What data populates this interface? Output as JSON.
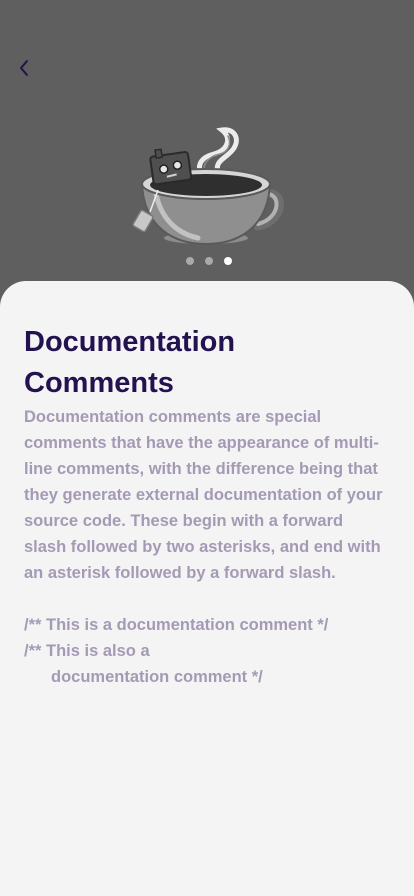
{
  "nav": {
    "back_icon": "chevron-left-icon"
  },
  "illustration": {
    "icon": "coffee-cup-robot-illustration"
  },
  "pager": {
    "count": 3,
    "active_index": 2
  },
  "content": {
    "title": "Documentation Comments",
    "paragraph": "Documentation comments are special comments that have the appearance of multi-line comments, with the difference being that they generate external documentation of your source code. These begin with a forward slash followed by two asterisks, and end with an asterisk followed by a forward slash.",
    "code_line_1": "/** This is a documentation comment */",
    "code_line_2": "/** This is also a",
    "code_line_3": "documentation comment */"
  },
  "colors": {
    "header_background": "#5f5f5f",
    "sheet_background": "#f4f4f4",
    "title": "#24114f",
    "body_text": "#a59ab5",
    "active_dot": "#ffffff",
    "inactive_dot": "#a9a9a9"
  }
}
